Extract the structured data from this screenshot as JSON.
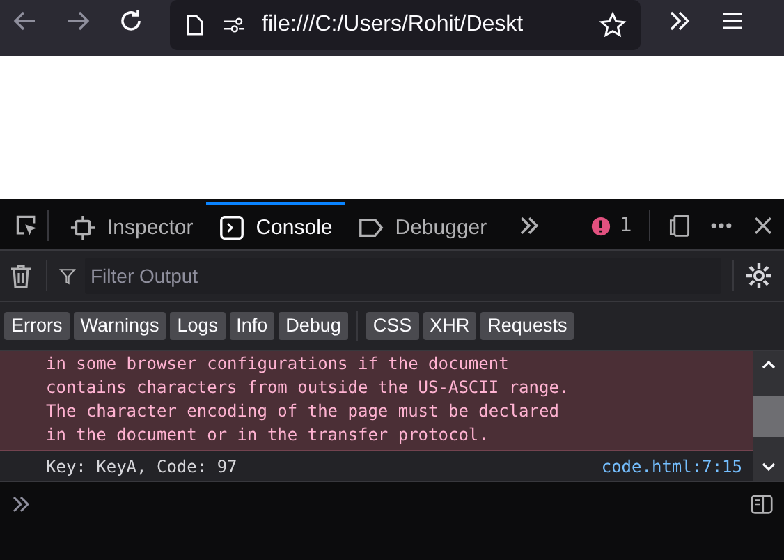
{
  "toolbar": {
    "url": "file:///C:/Users/Rohit/Deskt"
  },
  "devtools": {
    "tabs": [
      {
        "label": "Inspector",
        "selected": false
      },
      {
        "label": "Console",
        "selected": true
      },
      {
        "label": "Debugger",
        "selected": false
      }
    ],
    "error_count": "1"
  },
  "filter": {
    "placeholder": "Filter Output"
  },
  "filter_groups": [
    {
      "buttons": [
        {
          "label": "Errors",
          "selected": true
        },
        {
          "label": "Warnings",
          "selected": true
        },
        {
          "label": "Logs",
          "selected": true
        },
        {
          "label": "Info",
          "selected": true
        },
        {
          "label": "Debug",
          "selected": true
        }
      ]
    },
    {
      "buttons": [
        {
          "label": "CSS",
          "selected": true
        },
        {
          "label": "XHR",
          "selected": true
        },
        {
          "label": "Requests",
          "selected": true
        }
      ]
    }
  ],
  "messages": [
    {
      "kind": "error",
      "lines": [
        "in some browser configurations if the document",
        "contains characters from outside the US-ASCII range.",
        "The character encoding of the page must be declared",
        "in the document or in the transfer protocol."
      ]
    },
    {
      "kind": "log",
      "text": "Key: KeyA, Code: 97",
      "source": "code.html:7:15"
    }
  ]
}
